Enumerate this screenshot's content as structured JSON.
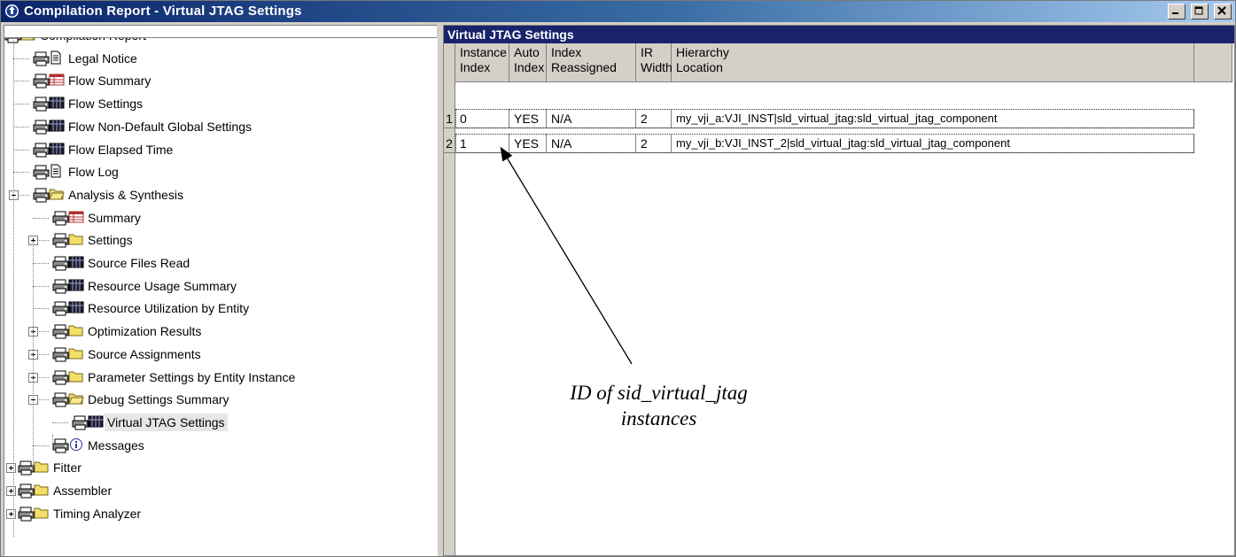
{
  "window": {
    "title": "Compilation Report - Virtual JTAG Settings",
    "buttons": [
      "minimize",
      "maximize",
      "close"
    ]
  },
  "tree": [
    {
      "label": "Compilation Report",
      "icon": "folder-open-icon",
      "level": 0
    },
    {
      "label": "Legal Notice",
      "icon": "document-icon",
      "level": 1
    },
    {
      "label": "Flow Summary",
      "icon": "summary-table-icon",
      "level": 1
    },
    {
      "label": "Flow Settings",
      "icon": "table-icon",
      "level": 1
    },
    {
      "label": "Flow Non-Default Global Settings",
      "icon": "table-icon",
      "level": 1
    },
    {
      "label": "Flow Elapsed Time",
      "icon": "table-icon",
      "level": 1
    },
    {
      "label": "Flow Log",
      "icon": "document-icon",
      "level": 1
    },
    {
      "label": "Analysis & Synthesis",
      "icon": "folder-open-icon",
      "level": 1,
      "expander": "minus"
    },
    {
      "label": "Summary",
      "icon": "summary-table-icon",
      "level": 2
    },
    {
      "label": "Settings",
      "icon": "folder-icon",
      "level": 2,
      "expander": "plus"
    },
    {
      "label": "Source Files Read",
      "icon": "table-icon",
      "level": 2
    },
    {
      "label": "Resource Usage Summary",
      "icon": "table-icon",
      "level": 2
    },
    {
      "label": "Resource Utilization by Entity",
      "icon": "table-icon",
      "level": 2
    },
    {
      "label": "Optimization Results",
      "icon": "folder-icon",
      "level": 2,
      "expander": "plus"
    },
    {
      "label": "Source Assignments",
      "icon": "folder-icon",
      "level": 2,
      "expander": "plus"
    },
    {
      "label": "Parameter Settings by Entity Instance",
      "icon": "folder-icon",
      "level": 2,
      "expander": "plus"
    },
    {
      "label": "Debug Settings Summary",
      "icon": "folder-open-icon",
      "level": 2,
      "expander": "minus"
    },
    {
      "label": "Virtual JTAG Settings",
      "icon": "table-icon",
      "level": 3,
      "selected": true
    },
    {
      "label": "Messages",
      "icon": "info-icon",
      "level": 2
    },
    {
      "label": "Fitter",
      "icon": "folder-icon",
      "level": 0,
      "expander": "plus"
    },
    {
      "label": "Assembler",
      "icon": "folder-icon",
      "level": 0,
      "expander": "plus"
    },
    {
      "label": "Timing Analyzer",
      "icon": "folder-icon",
      "level": 0,
      "expander": "plus"
    }
  ],
  "panel": {
    "title": "Virtual JTAG Settings",
    "columns": [
      {
        "line1": "Instance",
        "line2": "Index"
      },
      {
        "line1": "Auto",
        "line2": "Index"
      },
      {
        "line1": "Index",
        "line2": "Reassigned"
      },
      {
        "line1": "IR",
        "line2": "Width"
      },
      {
        "line1": "Hierarchy",
        "line2": "Location"
      }
    ],
    "rows": [
      {
        "num": "1",
        "cells": [
          "0",
          "YES",
          "N/A",
          "2",
          "my_vji_a:VJI_INST|sld_virtual_jtag:sld_virtual_jtag_component"
        ]
      },
      {
        "num": "2",
        "cells": [
          "1",
          "YES",
          "N/A",
          "2",
          "my_vji_b:VJI_INST_2|sld_virtual_jtag:sld_virtual_jtag_component"
        ]
      }
    ]
  },
  "annotation": {
    "line1": "ID of sid_virtual_jtag",
    "line2": "instances"
  }
}
